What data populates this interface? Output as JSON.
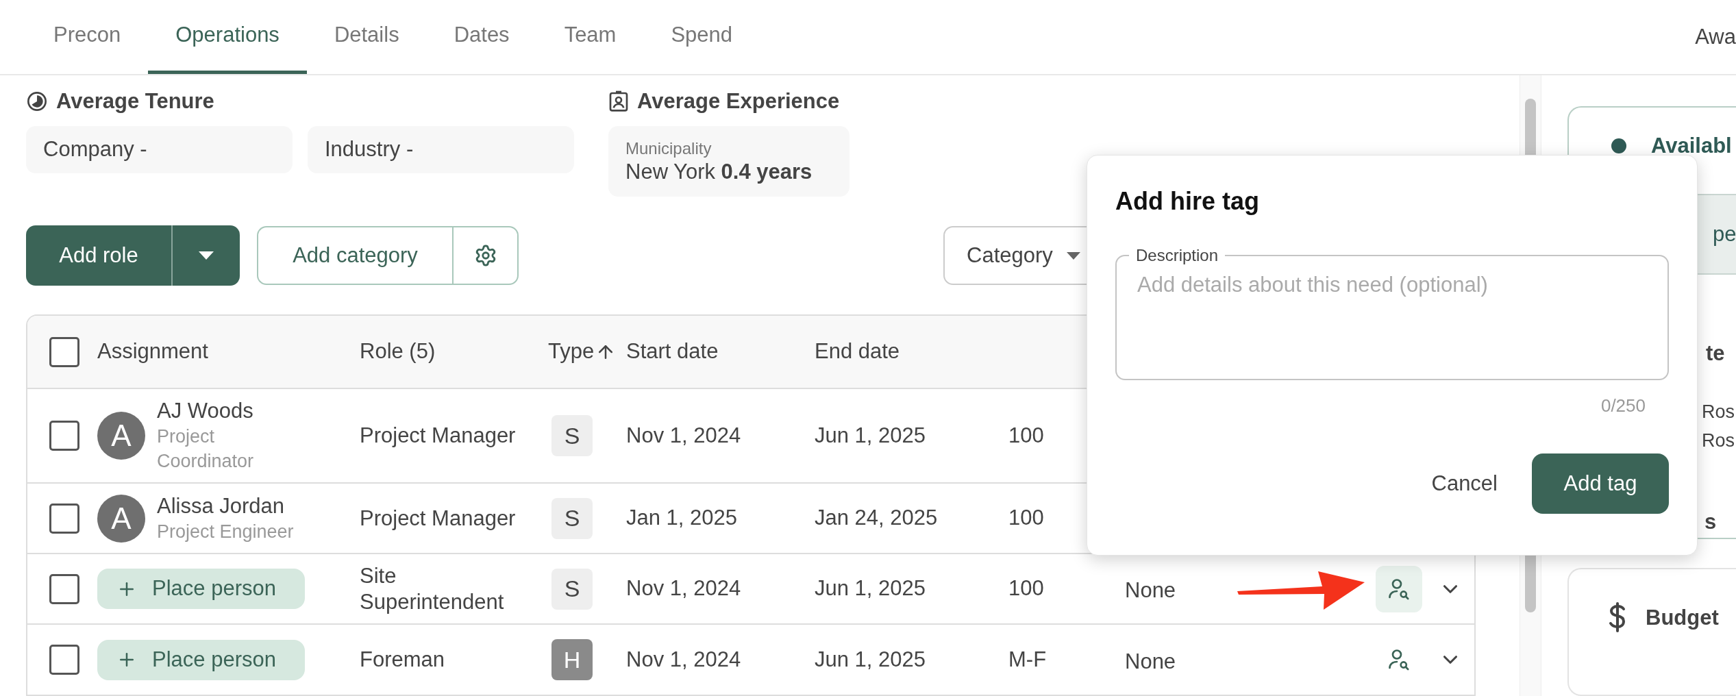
{
  "tabs": [
    {
      "label": "Precon",
      "selected": false
    },
    {
      "label": "Operations",
      "selected": true
    },
    {
      "label": "Details",
      "selected": false
    },
    {
      "label": "Dates",
      "selected": false
    },
    {
      "label": "Team",
      "selected": false
    },
    {
      "label": "Spend",
      "selected": false
    }
  ],
  "header_right": "Awa",
  "average_tenure": {
    "title": "Average Tenure",
    "cards": [
      "Company -",
      "Industry -"
    ]
  },
  "average_experience": {
    "title": "Average Experience",
    "label": "Municipality",
    "value": "New York **0.4 years**"
  },
  "toolbar": {
    "add_role": "Add role",
    "add_category": "Add category",
    "category_filter": "Category"
  },
  "table": {
    "header_checked": false,
    "columns": [
      "Assignment",
      "Role (5)",
      "Type",
      "Start date",
      "End date"
    ],
    "rows": [
      {
        "checked": false,
        "assignment": {
          "kind": "person",
          "initial": "A",
          "name": "AJ Woods",
          "title": "Project Coordinator"
        },
        "role": "Project Manager",
        "type": {
          "letter": "S",
          "kind": "light"
        },
        "start_date": "Nov 1, 2024",
        "end_date": "Jun 1, 2025",
        "column_6": "100"
      },
      {
        "checked": false,
        "assignment": {
          "kind": "person",
          "initial": "A",
          "name": "Alissa Jordan",
          "title": "Project Engineer"
        },
        "role": "Project Manager",
        "type": {
          "letter": "S",
          "kind": "light"
        },
        "start_date": "Jan 1, 2025",
        "end_date": "Jan 24, 2025",
        "column_6": "100"
      },
      {
        "checked": false,
        "assignment": {
          "kind": "placeholder",
          "label": "Place person"
        },
        "role": "Site Superintendent",
        "type": {
          "letter": "S",
          "kind": "light"
        },
        "start_date": "Nov 1, 2024",
        "end_date": "Jun 1, 2025",
        "column_6": "100",
        "column_7": "None",
        "hire_tag": {
          "selected": true
        }
      },
      {
        "checked": false,
        "assignment": {
          "kind": "placeholder",
          "label": "Place person"
        },
        "role": "Foreman",
        "type": {
          "letter": "H",
          "kind": "dark"
        },
        "start_date": "Nov 1, 2024",
        "end_date": "Jun 1, 2025",
        "column_6": "M-F",
        "column_7": "None",
        "hire_tag": {
          "selected": false
        }
      }
    ]
  },
  "popup": {
    "title": "Add hire tag",
    "field_label": "Description",
    "placeholder": "Add details about this need (optional)",
    "counter": "0/250",
    "cancel": "Cancel",
    "submit": "Add tag"
  },
  "right_panel": {
    "availability_card": {
      "title": "Availabl",
      "highlight": "pe",
      "heading": "te",
      "lines": [
        "Ros",
        "Ros"
      ],
      "footer": "s"
    },
    "budget_card": {
      "title": "Budget"
    }
  }
}
